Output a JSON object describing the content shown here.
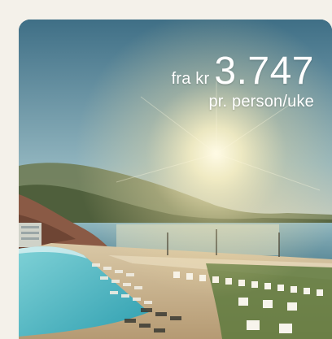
{
  "offer": {
    "price_prefix": "fra kr",
    "price_amount": "3.747",
    "price_suffix": "pr. person/uke"
  },
  "colors": {
    "page_background": "#f4f1ea",
    "price_text": "#ffffff"
  }
}
